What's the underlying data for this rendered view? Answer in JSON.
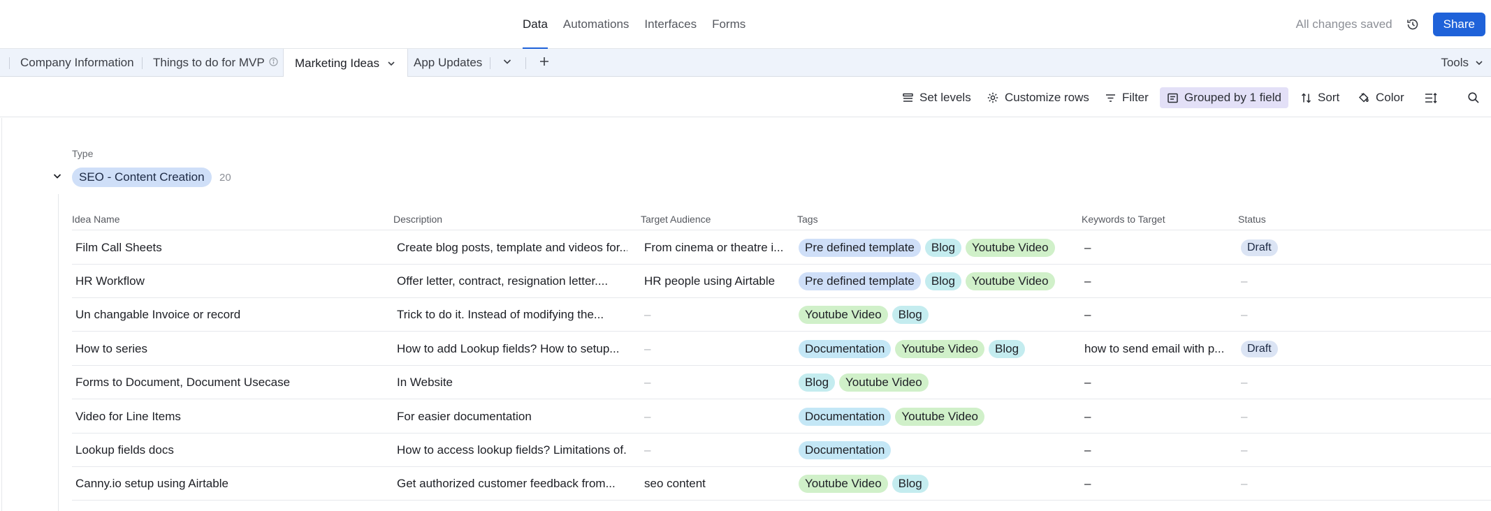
{
  "topbar": {
    "nav": [
      "Data",
      "Automations",
      "Interfaces",
      "Forms"
    ],
    "active_nav": "Data",
    "saved_text": "All changes saved",
    "share_label": "Share"
  },
  "tabs": {
    "items": [
      "Company Information",
      "Things to do for MVP",
      "Marketing Ideas",
      "App Updates"
    ],
    "active": "Marketing Ideas",
    "tools_label": "Tools"
  },
  "toolbar": {
    "set_levels": "Set levels",
    "customize_rows": "Customize rows",
    "filter": "Filter",
    "grouped": "Grouped by 1 field",
    "sort": "Sort",
    "color": "Color"
  },
  "group": {
    "field_label": "Type",
    "value": "SEO - Content Creation",
    "count": "20"
  },
  "table": {
    "headers": [
      "Idea Name",
      "Description",
      "Target Audience",
      "Tags",
      "Keywords to Target",
      "Status"
    ],
    "rows": [
      {
        "name": "Film Call Sheets",
        "description": "Create blog posts, template and videos for...",
        "audience": "From cinema or theatre i...",
        "tags": [
          "Pre defined template",
          "Blog",
          "Youtube Video"
        ],
        "keywords": "–",
        "status": "Draft"
      },
      {
        "name": "HR Workflow",
        "description": "Offer letter, contract, resignation letter....",
        "audience": "HR people using Airtable",
        "tags": [
          "Pre defined template",
          "Blog",
          "Youtube Video"
        ],
        "keywords": "–",
        "status": "–"
      },
      {
        "name": "Un changable Invoice or record",
        "description": "Trick to do it. Instead of modifying the...",
        "audience": "–",
        "tags": [
          "Youtube Video",
          "Blog"
        ],
        "keywords": "–",
        "status": "–"
      },
      {
        "name": "How to series",
        "description": "How to add Lookup fields? How to setup...",
        "audience": "–",
        "tags": [
          "Documentation",
          "Youtube Video",
          "Blog"
        ],
        "keywords": "how to send email with p...",
        "status": "Draft"
      },
      {
        "name": "Forms to Document, Document Usecase",
        "description": "In Website",
        "audience": "–",
        "tags": [
          "Blog",
          "Youtube Video"
        ],
        "keywords": "–",
        "status": "–"
      },
      {
        "name": "Video for Line Items",
        "description": "For easier documentation",
        "audience": "–",
        "tags": [
          "Documentation",
          "Youtube Video"
        ],
        "keywords": "–",
        "status": "–"
      },
      {
        "name": "Lookup fields docs",
        "description": "How to access lookup fields? Limitations of...",
        "audience": "–",
        "tags": [
          "Documentation"
        ],
        "keywords": "–",
        "status": "–"
      },
      {
        "name": "Canny.io setup using Airtable",
        "description": "Get authorized customer feedback from...",
        "audience": "seo content",
        "tags": [
          "Youtube Video",
          "Blog"
        ],
        "keywords": "–",
        "status": "–"
      }
    ]
  },
  "tag_colors": {
    "Pre defined template": "#cfdff8",
    "Blog": "#c4ecef",
    "Youtube Video": "#d0f0c9",
    "Documentation": "#c4e7f6"
  },
  "accent_color": "#1f62d9"
}
